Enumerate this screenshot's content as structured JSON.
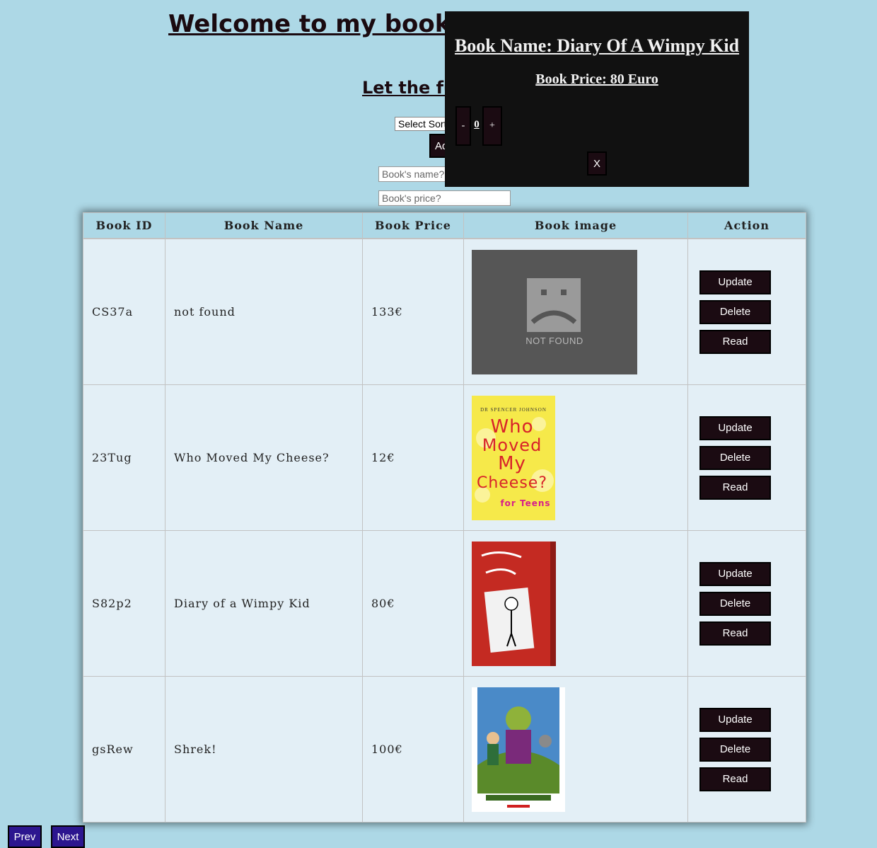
{
  "header": {
    "title": "Welcome to my book store",
    "subtitle": "Let the fun begin"
  },
  "controls": {
    "sort_select_value": "Select Sort",
    "add_button_label": "Add",
    "name_placeholder": "Book's name?",
    "price_placeholder": "Book's price?"
  },
  "table": {
    "headers": [
      "Book ID",
      "Book Name",
      "Book Price",
      "Book image",
      "Action"
    ],
    "rows": [
      {
        "id": "CS37a",
        "name": "not found",
        "price": "133€",
        "image": "not-found-placeholder",
        "image_caption": "NOT FOUND"
      },
      {
        "id": "23Tug",
        "name": "Who Moved My Cheese?",
        "price": "12€",
        "image": "who-moved-my-cheese-cover",
        "cover_author": "DR SPENCER JOHNSON",
        "cover_title": [
          "Who",
          "Moved",
          "My",
          "Cheese?"
        ],
        "cover_sub": "for Teens"
      },
      {
        "id": "S82p2",
        "name": "Diary of a Wimpy Kid",
        "price": "80€",
        "image": "diary-of-a-wimpy-kid-cover"
      },
      {
        "id": "gsRew",
        "name": "Shrek!",
        "price": "100€",
        "image": "shrek-the-third-cover"
      }
    ],
    "actions": {
      "update": "Update",
      "delete": "Delete",
      "read": "Read"
    }
  },
  "pagination": {
    "prev": "Prev",
    "next": "Next"
  },
  "modal": {
    "name_line": "Book Name: Diary Of A Wimpy Kid",
    "price_line": "Book Price: 80 Euro",
    "minus": "-",
    "quantity": "0",
    "plus": "+",
    "close": "X"
  },
  "colors": {
    "page_bg": "#add8e6",
    "table_bg": "#e3eff6",
    "button_bg": "#1b0b12",
    "pager_bg": "#2c168f",
    "modal_bg": "#111111"
  }
}
